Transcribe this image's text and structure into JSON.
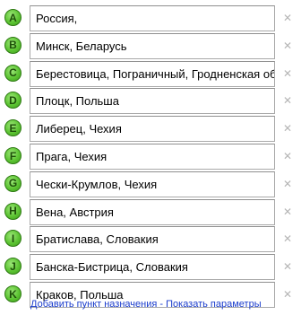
{
  "route": {
    "waypoints": [
      {
        "letter": "A",
        "value": "Россия,"
      },
      {
        "letter": "B",
        "value": "Минск, Беларусь"
      },
      {
        "letter": "C",
        "value": "Берестовица, Пограничный, Гродненская об"
      },
      {
        "letter": "D",
        "value": "Плоцк, Польша"
      },
      {
        "letter": "E",
        "value": "Либерец, Чехия"
      },
      {
        "letter": "F",
        "value": "Прага, Чехия"
      },
      {
        "letter": "G",
        "value": "Чески-Крумлов, Чехия"
      },
      {
        "letter": "H",
        "value": "Вена, Австрия"
      },
      {
        "letter": "I",
        "value": "Братислава, Словакия"
      },
      {
        "letter": "J",
        "value": "Банска-Бистрица, Словакия"
      },
      {
        "letter": "K",
        "value": "Краков, Польша"
      }
    ],
    "remove_symbol": "✕"
  },
  "footer": {
    "add_destination_label": "Добавить пункт назначения",
    "separator": " - ",
    "show_options_label": "Показать параметры"
  },
  "colors": {
    "marker_green": "#5cc432",
    "link_blue": "#1a3ccc",
    "remove_gray": "#b5b5b5"
  }
}
